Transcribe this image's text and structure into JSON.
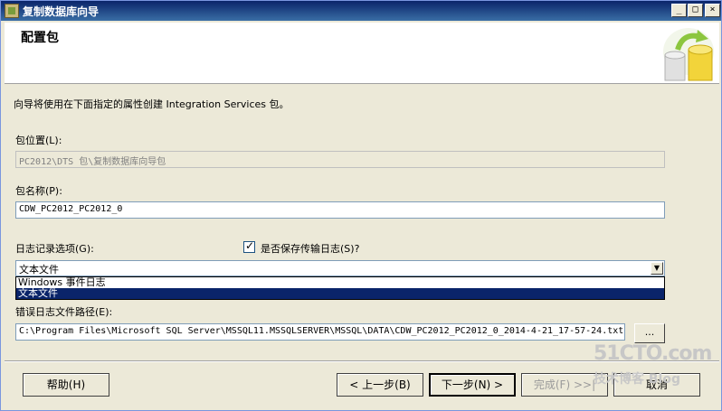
{
  "window": {
    "title": "复制数据库向导",
    "min_glyph": "_",
    "max_glyph": "□",
    "close_glyph": "×"
  },
  "header": {
    "title": "配置包"
  },
  "intro": "向导将使用在下面指定的属性创建 Integration Services 包。",
  "package_location": {
    "label": "包位置(L):",
    "value": "PC2012\\DTS 包\\复制数据库向导包"
  },
  "package_name": {
    "label": "包名称(P):",
    "value": "CDW_PC2012_PC2012_0"
  },
  "logging": {
    "label": "日志记录选项(G):",
    "save_transfer_log_label": "是否保存传输日志(S)?",
    "save_transfer_log_checked": true,
    "selected": "文本文件",
    "options": [
      "Windows 事件日志",
      "文本文件"
    ]
  },
  "error_log": {
    "label": "错误日志文件路径(E):",
    "value": "C:\\Program Files\\Microsoft SQL Server\\MSSQL11.MSSQLSERVER\\MSSQL\\DATA\\CDW_PC2012_PC2012_0_2014-4-21_17-57-24.txt",
    "browse_label": "..."
  },
  "buttons": {
    "help": "帮助(H)",
    "back": "< 上一步(B)",
    "next": "下一步(N) >",
    "finish": "完成(F) >>|",
    "cancel": "取消"
  },
  "watermark": {
    "top": "51CTO.com",
    "bottom": "技术博客 Blog"
  }
}
